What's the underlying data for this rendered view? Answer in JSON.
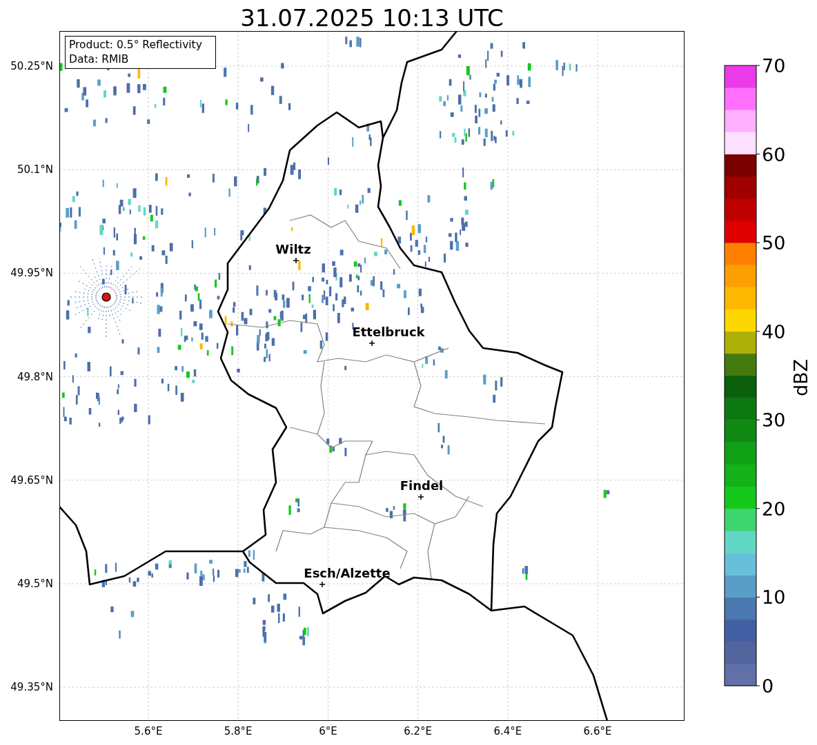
{
  "title": "31.07.2025 10:13 UTC",
  "info_box": [
    "Product: 0.5° Reflectivity",
    "Data: RMIB"
  ],
  "map": {
    "lat_ticks": [
      "50.25°N",
      "50.1°N",
      "49.95°N",
      "49.8°N",
      "49.65°N",
      "49.5°N",
      "49.35°N"
    ],
    "lon_ticks": [
      "5.6°E",
      "5.8°E",
      "6°E",
      "6.2°E",
      "6.4°E",
      "6.6°E"
    ],
    "cities": [
      {
        "name": "Wiltz"
      },
      {
        "name": "Ettelbruck"
      },
      {
        "name": "Findel"
      },
      {
        "name": "Esch/Alzette"
      }
    ]
  },
  "colorbar": {
    "label": "dBZ",
    "ticks": [
      "70",
      "60",
      "50",
      "40",
      "30",
      "20",
      "10",
      "0"
    ],
    "bins": [
      {
        "color": "#6270a8"
      },
      {
        "color": "#53659f"
      },
      {
        "color": "#4460a4"
      },
      {
        "color": "#4a78b0"
      },
      {
        "color": "#5a9ec8"
      },
      {
        "color": "#66c0dc"
      },
      {
        "color": "#62d6c4"
      },
      {
        "color": "#3ed46f"
      },
      {
        "color": "#14c81c"
      },
      {
        "color": "#12b218"
      },
      {
        "color": "#10a016"
      },
      {
        "color": "#0e8a12"
      },
      {
        "color": "#0c7810"
      },
      {
        "color": "#0a600b"
      },
      {
        "color": "#457a0e"
      },
      {
        "color": "#adb006"
      },
      {
        "color": "#ffd700"
      },
      {
        "color": "#ffb800"
      },
      {
        "color": "#ff9e00"
      },
      {
        "color": "#ff8000"
      },
      {
        "color": "#e00000"
      },
      {
        "color": "#c00000"
      },
      {
        "color": "#a00000"
      },
      {
        "color": "#7a0000"
      },
      {
        "color": "#ffdfff"
      },
      {
        "color": "#ffb0ff"
      },
      {
        "color": "#ff70ff"
      },
      {
        "color": "#ea3aea"
      }
    ]
  }
}
